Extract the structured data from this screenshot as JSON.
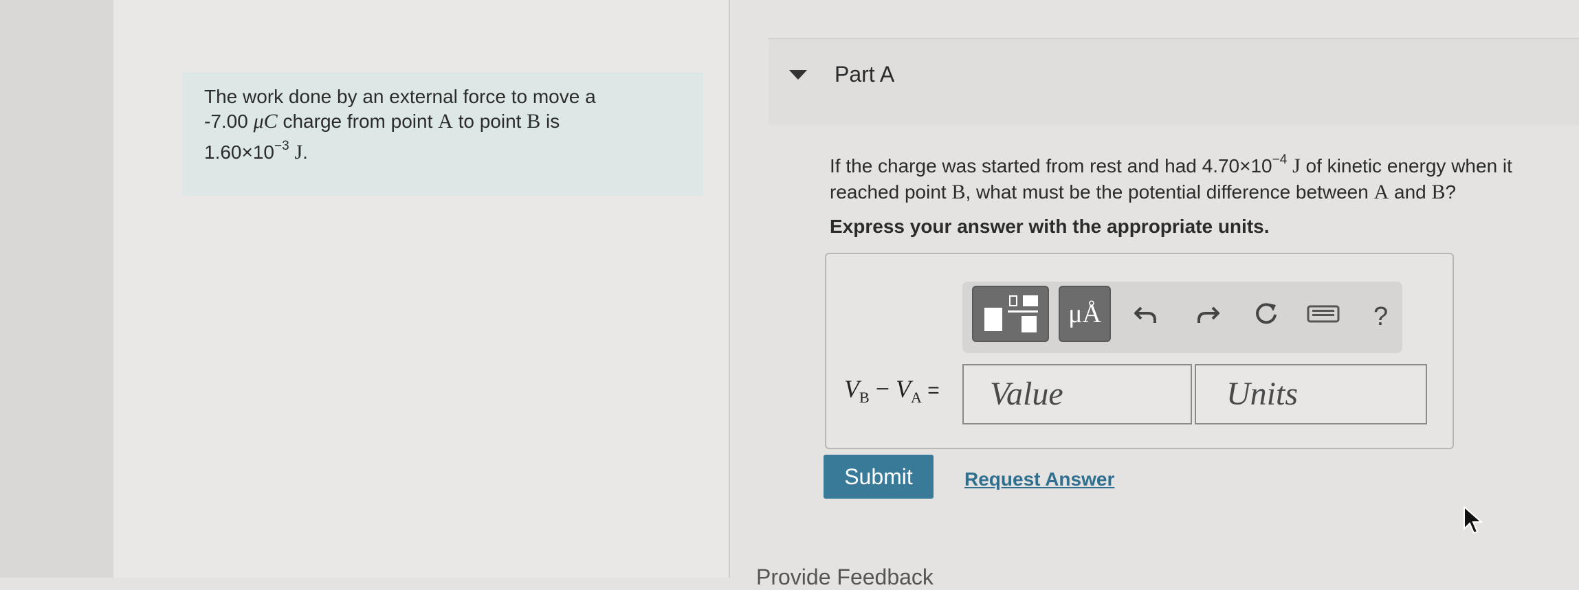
{
  "problem": {
    "line1": "The work done by an external force to move a",
    "line2_charge": "-7.00",
    "line2_unit": "μC",
    "line2_text": "charge from point",
    "point_a": "A",
    "line2_to": "to point",
    "point_b": "B",
    "line2_is": "is",
    "work_mantissa": "1.60×10",
    "work_exp": "−3",
    "work_unit": "J",
    "work_end": "."
  },
  "part": {
    "title": "Part A",
    "question_start": "If the charge was started from rest and had",
    "ke_mantissa": "4.70×10",
    "ke_exp": "−4",
    "ke_unit": "J",
    "question_mid": "of kinetic energy when it reached point",
    "point_b": "B",
    "question_end": ", what must be the potential difference between",
    "point_a2": "A",
    "and": "and",
    "point_b2": "B",
    "qmark": "?",
    "instruction": "Express your answer with the appropriate units."
  },
  "toolbar": {
    "units_label": "μÅ",
    "help_label": "?"
  },
  "answer": {
    "var_v1": "V",
    "sub_b": "B",
    "minus": " − ",
    "var_v2": "V",
    "sub_a": "A",
    "equals": " =",
    "value_placeholder": "Value",
    "units_placeholder": "Units"
  },
  "actions": {
    "submit": "Submit",
    "request_answer": "Request Answer"
  },
  "footer": {
    "feedback": "Provide Feedback"
  }
}
